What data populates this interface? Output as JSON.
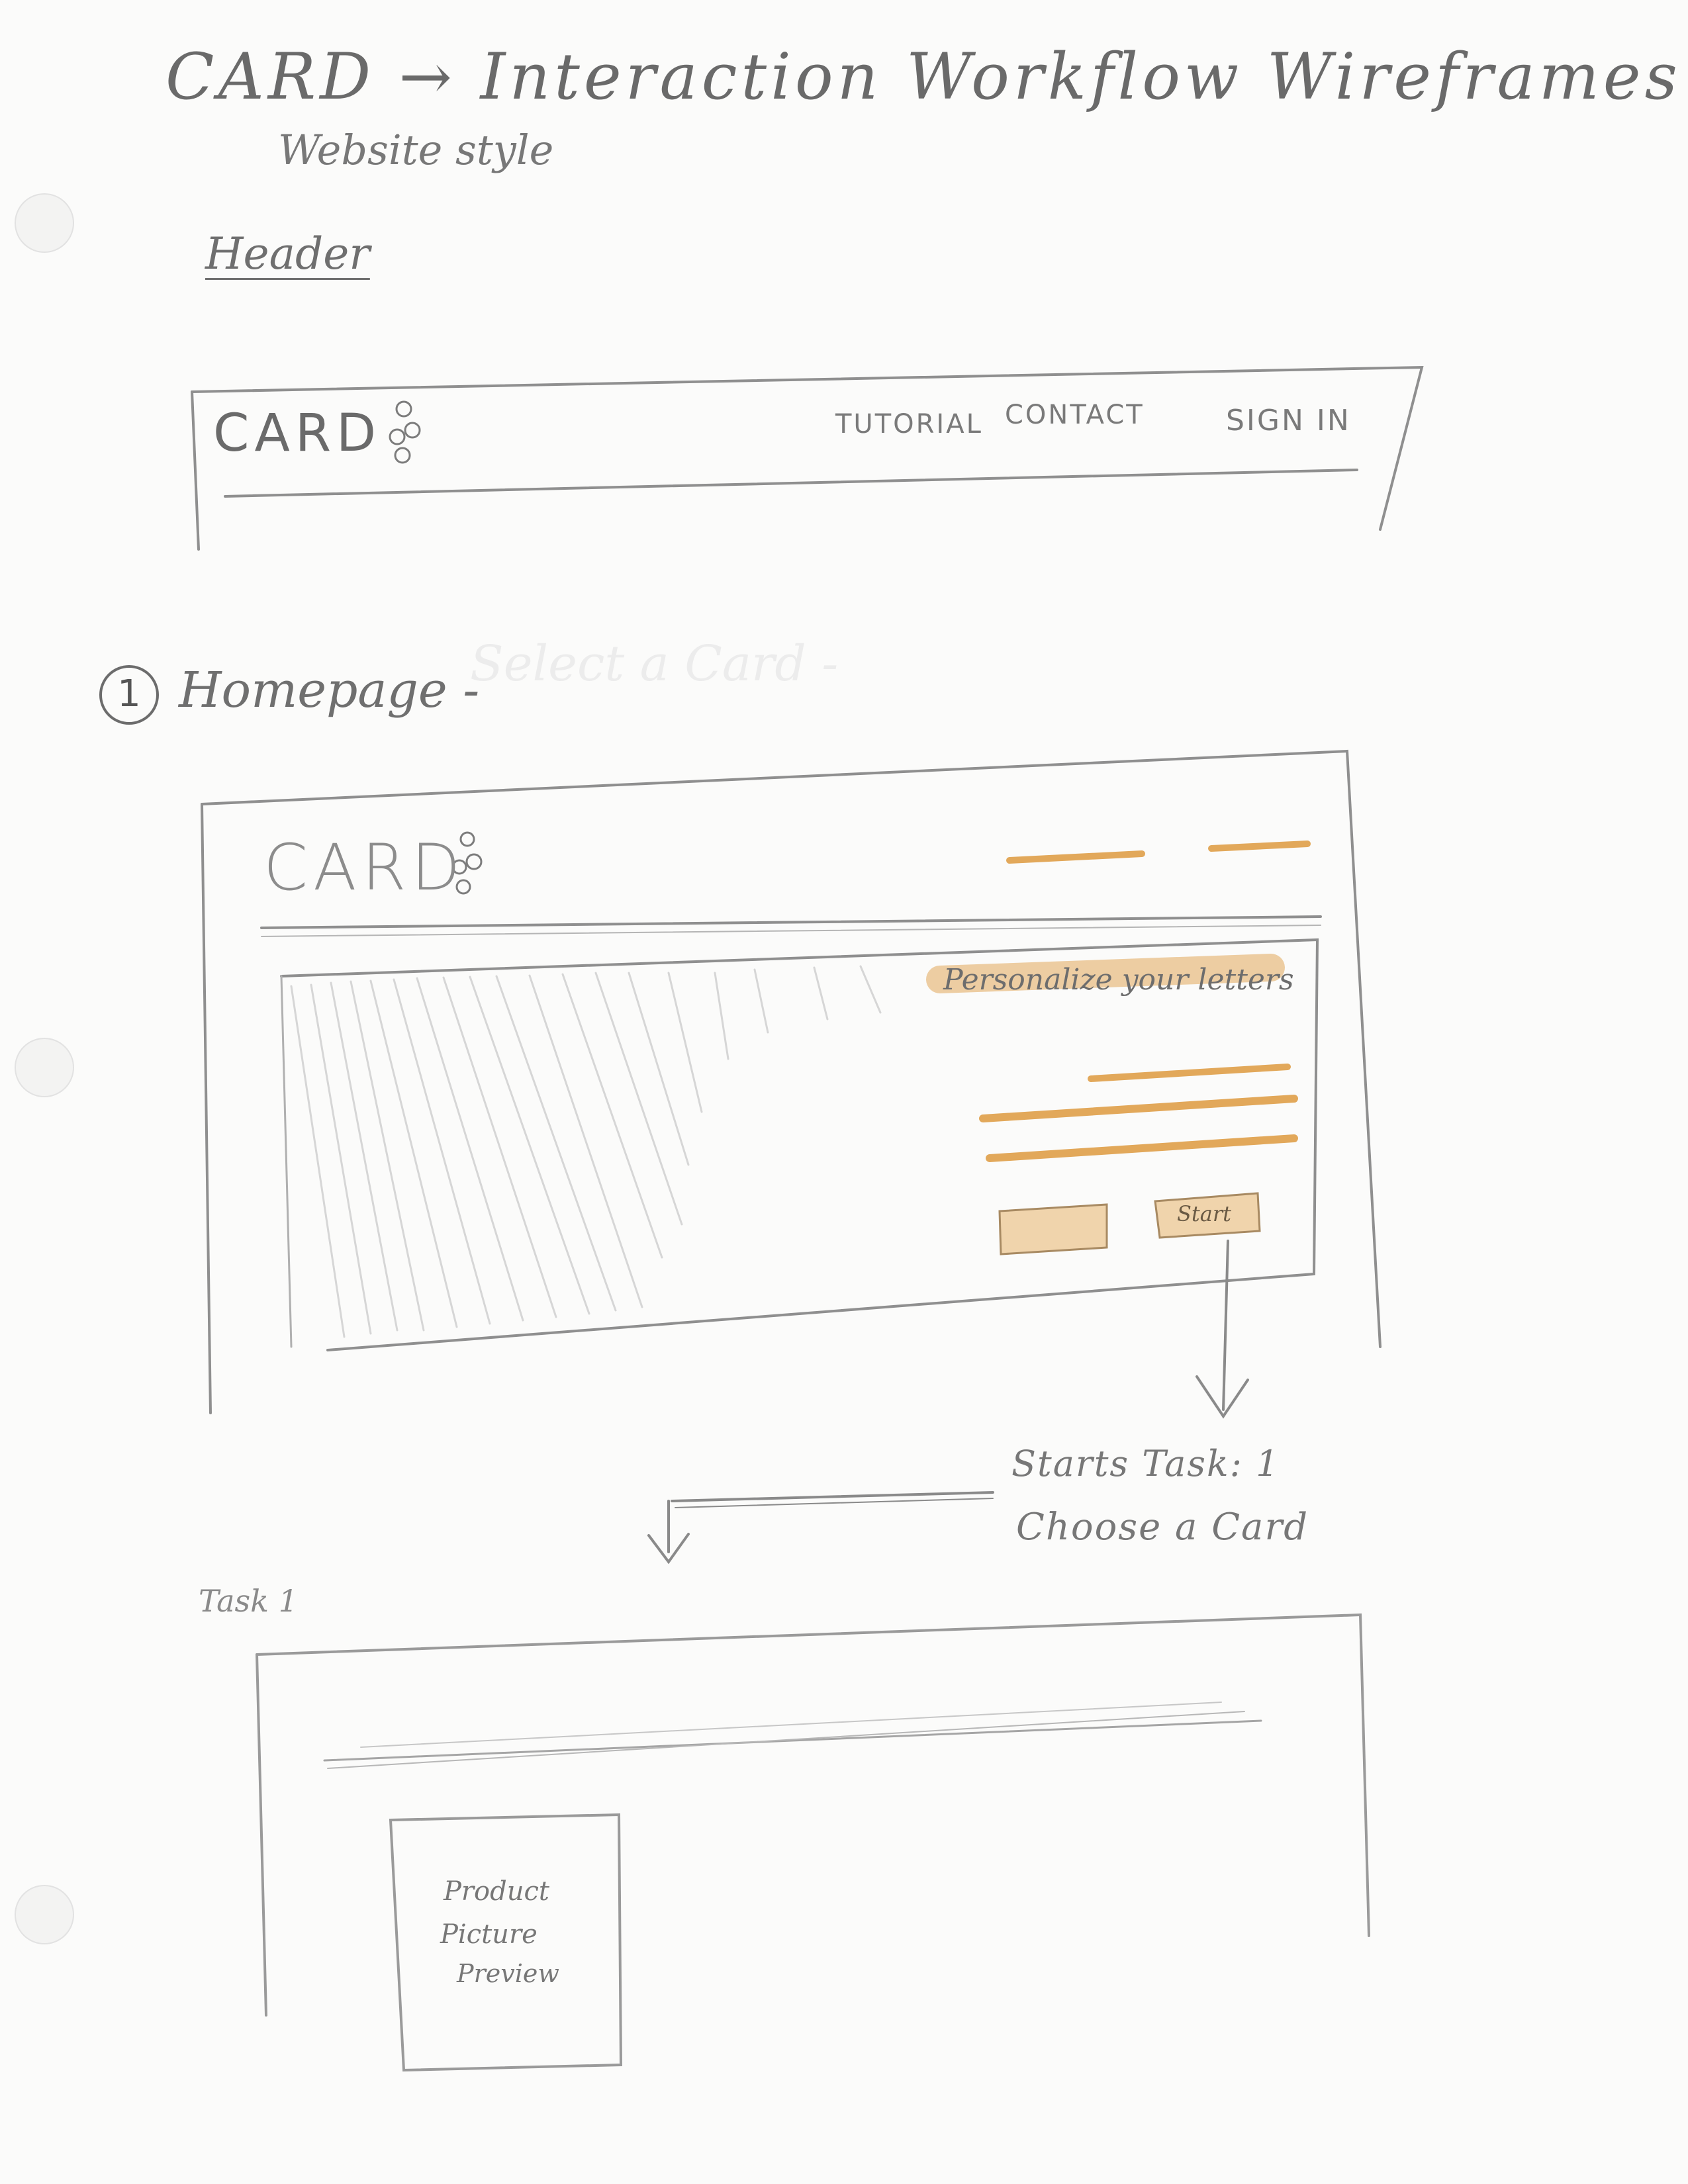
{
  "page": {
    "title": "CARD → Interaction Workflow Wireframes",
    "subtitle": "Website style"
  },
  "header_section": {
    "label": "Header",
    "wireframe": {
      "logo": "CARD",
      "nav": [
        "TUTORIAL",
        "CONTACT",
        "SIGN IN"
      ]
    }
  },
  "homepage_section": {
    "number": "1",
    "label": "Homepage -",
    "faded_text": "Select a Card -",
    "wireframe": {
      "logo": "CARD",
      "hero_text": "Personalize your letters",
      "start_button": "Start"
    }
  },
  "flow_note": {
    "line1": "Starts Task: 1",
    "line2": "Choose a Card"
  },
  "task_section": {
    "label": "Task 1",
    "product_box": [
      "Product",
      "Picture",
      "Preview"
    ]
  },
  "colors": {
    "pencil": "#8a8a8a",
    "highlighter": "#e2a85a"
  }
}
